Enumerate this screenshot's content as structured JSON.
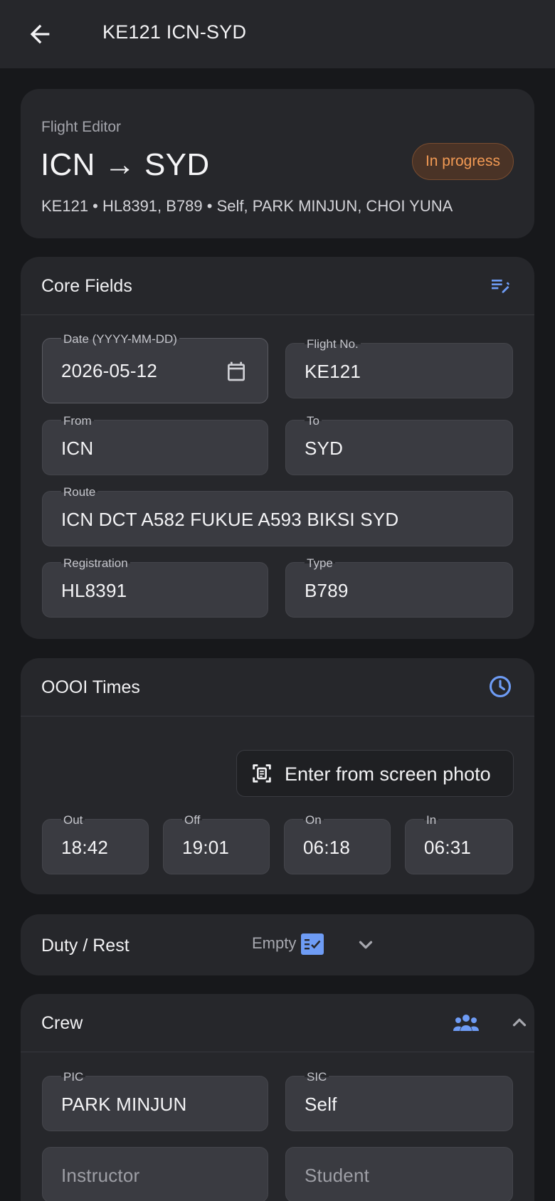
{
  "appbar": {
    "title": "KE121 ICN-SYD",
    "back_icon": "arrow-left-icon"
  },
  "summary": {
    "eyebrow": "Flight Editor",
    "route_title": "ICN → SYD",
    "status": "In progress",
    "status_color": "#f29a54",
    "meta": "KE121  •  HL8391, B789  •  Self, PARK MINJUN, CHOI YUNA"
  },
  "core": {
    "title": "Core Fields",
    "header_icon": "edit-note-icon",
    "date": {
      "label": "Date (YYYY-MM-DD)",
      "value": "2026-05-12"
    },
    "flight_no": {
      "label": "Flight No.",
      "value": "KE121"
    },
    "from": {
      "label": "From",
      "value": "ICN"
    },
    "to": {
      "label": "To",
      "value": "SYD"
    },
    "route": {
      "label": "Route",
      "value": "ICN DCT A582 FUKUE A593 BIKSI SYD"
    },
    "registration": {
      "label": "Registration",
      "value": "HL8391"
    },
    "type": {
      "label": "Type",
      "value": "B789"
    }
  },
  "oooi": {
    "title": "OOOI Times",
    "header_icon": "clock-icon",
    "photo_button": "Enter from screen photo",
    "out": {
      "label": "Out",
      "value": "18:42"
    },
    "off": {
      "label": "Off",
      "value": "19:01"
    },
    "on": {
      "label": "On",
      "value": "06:18"
    },
    "in": {
      "label": "In",
      "value": "06:31"
    }
  },
  "duty": {
    "title": "Duty / Rest",
    "status": "Empty",
    "icon": "checklist-icon"
  },
  "crew": {
    "title": "Crew",
    "header_icon": "group-icon",
    "pic": {
      "label": "PIC",
      "value": "PARK MINJUN"
    },
    "sic": {
      "label": "SIC",
      "value": "Self"
    },
    "instructor": {
      "placeholder": "Instructor"
    },
    "student": {
      "placeholder": "Student"
    }
  },
  "accent_color": "#6e9cf5"
}
